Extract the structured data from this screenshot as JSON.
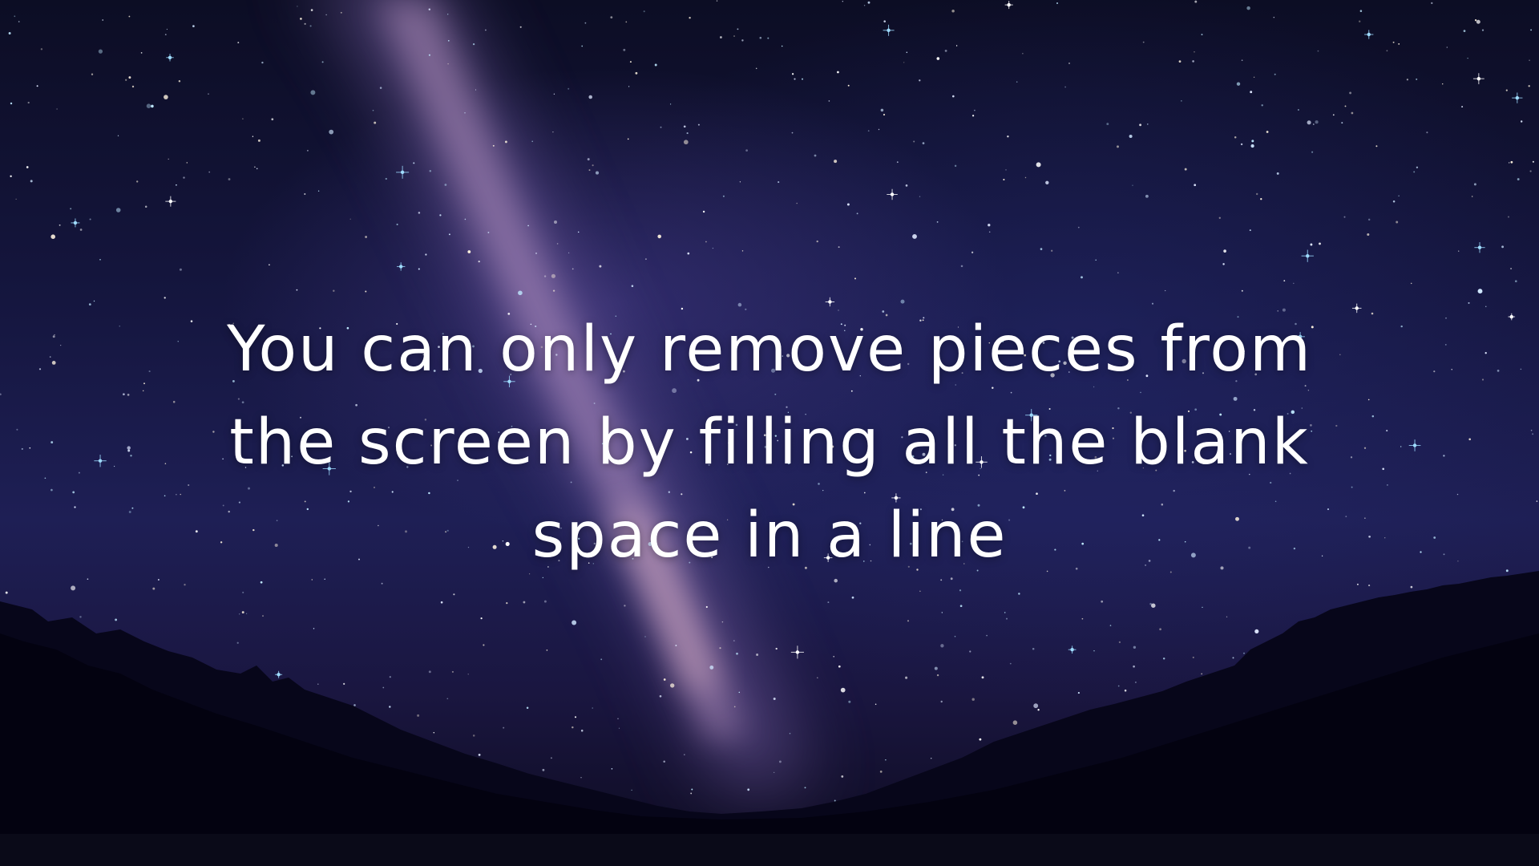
{
  "caption": {
    "lines": [
      "You can only remove pieces from",
      "the screen by filling all the blank",
      "space in a line"
    ]
  },
  "colors": {
    "sky_top": "#0c0d24",
    "sky_mid": "#1e1f55",
    "milky_way": "#b79ac9",
    "silhouette": "#050510",
    "text": "#ffffff"
  }
}
